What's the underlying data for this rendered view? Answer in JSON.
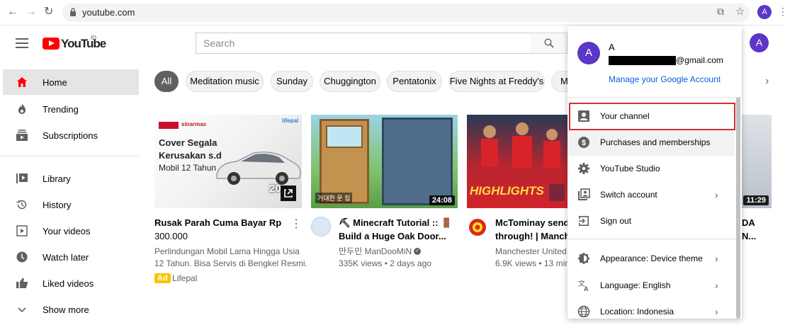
{
  "browser": {
    "url": "youtube.com",
    "avatar_letter": "A"
  },
  "header": {
    "logo_text": "YouTube",
    "logo_region": "ID",
    "search_placeholder": "Search",
    "avatar_letter": "A"
  },
  "sidebar": {
    "items": [
      {
        "label": "Home",
        "icon": "home-icon"
      },
      {
        "label": "Trending",
        "icon": "flame-icon"
      },
      {
        "label": "Subscriptions",
        "icon": "subscriptions-icon"
      },
      {
        "label": "Library",
        "icon": "library-icon"
      },
      {
        "label": "History",
        "icon": "history-icon"
      },
      {
        "label": "Your videos",
        "icon": "your-videos-icon"
      },
      {
        "label": "Watch later",
        "icon": "clock-icon"
      },
      {
        "label": "Liked videos",
        "icon": "thumbs-up-icon"
      },
      {
        "label": "Show more",
        "icon": "chevron-down-icon"
      }
    ]
  },
  "chips": [
    "All",
    "Meditation music",
    "Sunday",
    "Chuggington",
    "Pentatonix",
    "Five Nights at Freddy's",
    "M"
  ],
  "videos": [
    {
      "title_line1": "Rusak Parah Cuma Bayar Rp",
      "title_line2": "300.000",
      "meta1": "Perlindungan Mobil Lama Hingga Usia",
      "meta2": "12 Tahun. Bisa Servis di Bengkel Resmi.",
      "ad_badge": "Ad",
      "advertiser": "Lifepal",
      "thumb_brand": "sinarmas",
      "thumb_partner": "lifepal",
      "thumb_head1": "Cover Segala",
      "thumb_head2": "Kerusakan s.d",
      "thumb_head3": "Mobil 12 Tahun",
      "thumb_stat": "20"
    },
    {
      "title_line1": "⛏ Minecraft Tutorial :: 🚪",
      "title_line2": "Build a Huge Oak Door...",
      "channel": "만두민 ManDooMiN",
      "meta2": "335K views • 2 days ago",
      "duration": "24:08"
    },
    {
      "title_line1": "McTominay sends t",
      "title_line2": "through! | Manchest",
      "channel": "Manchester United",
      "meta2": "6.9K views • 13 min",
      "thumb_text": "HIGHLIGHTS"
    },
    {
      "title_line1": "DA",
      "title_line2": "N...",
      "duration": "11:29"
    }
  ],
  "account_menu": {
    "avatar_letter": "A",
    "name": "A",
    "email": "@gmail.com",
    "manage_link": "Manage your Google Account",
    "items": [
      {
        "label": "Your channel",
        "icon": "channel-icon",
        "chevron": false
      },
      {
        "label": "Purchases and memberships",
        "icon": "dollar-icon",
        "chevron": false
      },
      {
        "label": "YouTube Studio",
        "icon": "gear-icon",
        "chevron": false
      },
      {
        "label": "Switch account",
        "icon": "switch-account-icon",
        "chevron": true
      },
      {
        "label": "Sign out",
        "icon": "sign-out-icon",
        "chevron": false
      },
      {
        "label": "Appearance: Device theme",
        "icon": "appearance-icon",
        "chevron": true
      },
      {
        "label": "Language: English",
        "icon": "language-icon",
        "chevron": true
      },
      {
        "label": "Location: Indonesia",
        "icon": "globe-icon",
        "chevron": true
      }
    ],
    "chevron_glyph": "›"
  },
  "colors": {
    "brand_red": "#ff0000",
    "avatar_purple": "#5c35c9",
    "link_blue": "#065fd4",
    "highlight_red": "#d32f2f"
  }
}
